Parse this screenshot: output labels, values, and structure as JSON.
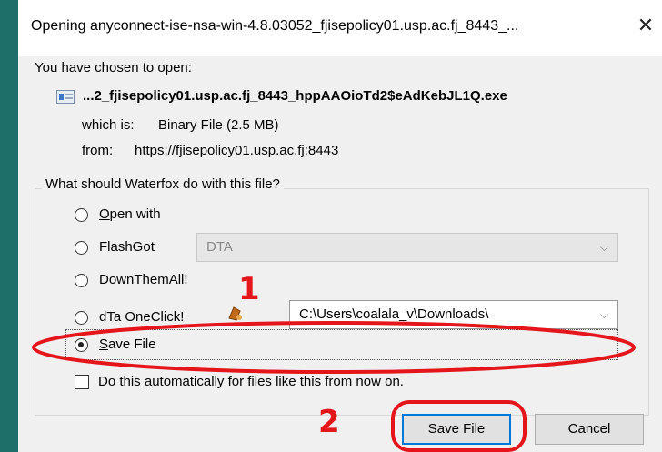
{
  "window": {
    "title": "Opening anyconnect-ise-nsa-win-4.8.03052_fjisepolicy01.usp.ac.fj_8443_...",
    "close_glyph": "✕"
  },
  "intro": {
    "chosen_label": "You have chosen to open:",
    "filename": "...2_fjisepolicy01.usp.ac.fj_8443_hppAAOioTd2$eAdKebJL1Q.exe",
    "which_is_label": "which is:",
    "which_is_value": "Binary File (2.5 MB)",
    "from_label": "from:",
    "from_value": "https://fjisepolicy01.usp.ac.fj:8443"
  },
  "group": {
    "legend": "What should Waterfox do with this file?",
    "options": [
      {
        "label_first": "O",
        "label_rest": "pen with",
        "selected": false
      },
      {
        "label": "FlashGot",
        "selected": false,
        "combo_value": "DTA",
        "combo_enabled": false
      },
      {
        "label": "DownThemAll!",
        "selected": false
      },
      {
        "label": "dTa OneClick!",
        "selected": false,
        "combo_value": "C:\\Users\\coalala_v\\Downloads\\",
        "combo_enabled": true
      },
      {
        "label_first": "S",
        "label_rest": "ave File",
        "selected": true
      }
    ],
    "auto_before": "Do this ",
    "auto_accel": "a",
    "auto_after": "utomatically for files like this from now on.",
    "auto_checked": false
  },
  "buttons": {
    "save": "Save File",
    "cancel": "Cancel"
  },
  "annotations": {
    "step1": "1",
    "step2": "2",
    "highlight_color": "#e4161b"
  },
  "icons": {
    "file": "exe-file-icon",
    "chevron": "chevron-down-icon",
    "addon": "dta-addon-icon"
  }
}
